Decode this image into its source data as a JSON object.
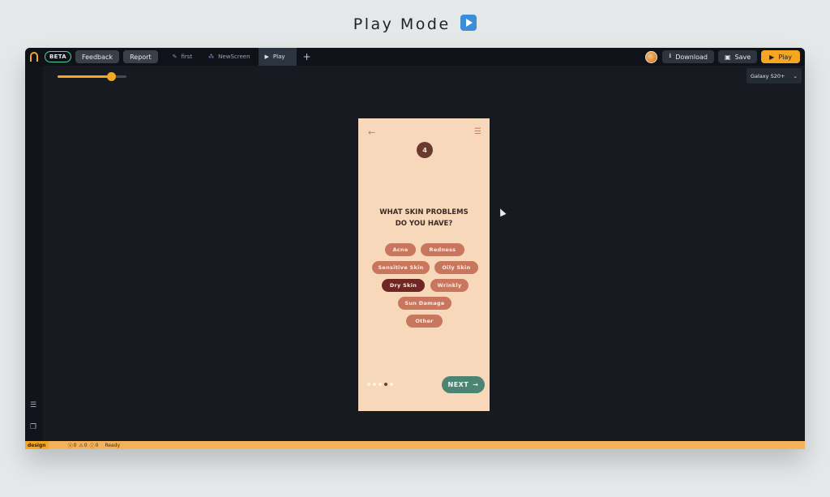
{
  "page_title": "Play Mode",
  "topbar": {
    "beta": "BETA",
    "feedback": "Feedback",
    "report": "Report",
    "tabs": [
      {
        "label": "first",
        "icon": "✎"
      },
      {
        "label": "NewScreen",
        "icon": "⁂"
      },
      {
        "label": "Play",
        "icon": "▶"
      }
    ],
    "add_tab": "+",
    "download": "Download",
    "save": "Save",
    "play": "Play"
  },
  "canvas": {
    "zoom_fraction": 0.78,
    "device_select": "Galaxy S20+"
  },
  "phone": {
    "step": "4",
    "question_line1": "WHAT SKIN PROBLEMS",
    "question_line2": "DO YOU HAVE?",
    "chips": [
      {
        "label": "Acne",
        "selected": false
      },
      {
        "label": "Redness",
        "selected": false
      },
      {
        "label": "Sensitive Skin",
        "selected": false
      },
      {
        "label": "Oily Skin",
        "selected": false
      },
      {
        "label": "Dry Skin",
        "selected": true
      },
      {
        "label": "Wrinkly",
        "selected": false
      },
      {
        "label": "Sun Damage",
        "selected": false
      },
      {
        "label": "Other",
        "selected": false
      }
    ],
    "pagination": {
      "total": 5,
      "current": 4
    },
    "next": "NEXT"
  },
  "statusbar": {
    "mode": "design",
    "errors": "0",
    "warnings": "0",
    "infos": "0",
    "state": "Ready"
  },
  "colors": {
    "accent": "#f5a623",
    "phone_bg": "#f7d8bb",
    "chip": "#c9765f",
    "chip_selected": "#6e2722",
    "next_button": "#4c8473"
  }
}
